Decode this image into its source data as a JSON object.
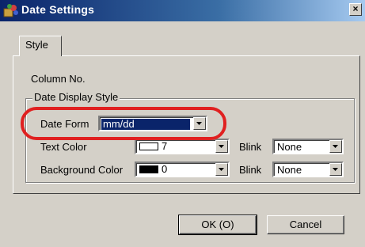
{
  "window": {
    "title": "Date Settings",
    "close_glyph": "×"
  },
  "tabs": [
    {
      "label": "Style"
    }
  ],
  "fields": {
    "column_no_label": "Column No.",
    "group_title": "Date Display Style",
    "date_form": {
      "label": "Date Form",
      "value": "mm/dd"
    },
    "text_color": {
      "label": "Text Color",
      "value": "7",
      "swatch": "#ffffff"
    },
    "background_color": {
      "label": "Background Color",
      "value": "0",
      "swatch": "#000000"
    },
    "blink_label": "Blink",
    "text_blink": {
      "value": "None"
    },
    "background_blink": {
      "value": "None"
    }
  },
  "buttons": {
    "ok": "OK (O)",
    "cancel": "Cancel"
  },
  "colors": {
    "highlight": "#e02020",
    "dialog_bg": "#d4d0c8",
    "titlebar": "#0a246a"
  }
}
